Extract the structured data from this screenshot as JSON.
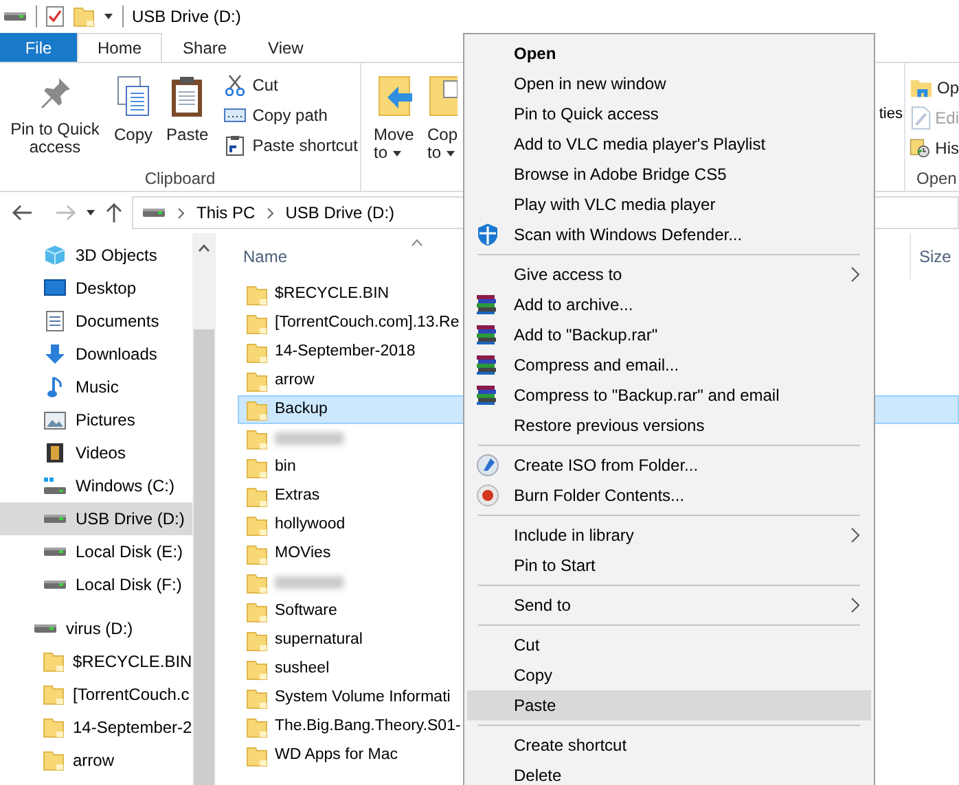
{
  "title_bar": {
    "title": "USB Drive (D:)"
  },
  "ribbon_tabs": [
    {
      "label": "File",
      "kind": "file",
      "selected": false
    },
    {
      "label": "Home",
      "kind": "tab",
      "selected": true
    },
    {
      "label": "Share",
      "kind": "tab",
      "selected": false
    },
    {
      "label": "View",
      "kind": "tab",
      "selected": false
    }
  ],
  "ribbon": {
    "clipboard": {
      "label": "Clipboard",
      "large_buttons": [
        "Pin to Quick access",
        "Copy",
        "Paste"
      ],
      "small_buttons": [
        "Cut",
        "Copy path",
        "Paste shortcut"
      ]
    },
    "organize": {
      "buttons": [
        {
          "lines": [
            "Move",
            "to"
          ]
        },
        {
          "lines": [
            "Cop",
            "to"
          ]
        }
      ]
    },
    "properties_fragment": "ties",
    "open": {
      "label": "Open",
      "buttons": [
        {
          "label": "Op",
          "disabled": false
        },
        {
          "label": "Edi",
          "disabled": true
        },
        {
          "label": "His",
          "disabled": false
        }
      ]
    }
  },
  "address_bar": {
    "crumbs": [
      "This PC",
      "USB Drive (D:)"
    ]
  },
  "navigation_pane": {
    "items": [
      {
        "label": "3D Objects",
        "selected": false
      },
      {
        "label": "Desktop",
        "selected": false
      },
      {
        "label": "Documents",
        "selected": false
      },
      {
        "label": "Downloads",
        "selected": false
      },
      {
        "label": "Music",
        "selected": false
      },
      {
        "label": "Pictures",
        "selected": false
      },
      {
        "label": "Videos",
        "selected": false
      },
      {
        "label": "Windows (C:)",
        "selected": false
      },
      {
        "label": "USB Drive (D:)",
        "selected": true
      },
      {
        "label": "Local Disk (E:)",
        "selected": false
      },
      {
        "label": "Local Disk (F:)",
        "selected": false
      }
    ],
    "tree": {
      "label": "virus (D:)",
      "children": [
        {
          "label": "$RECYCLE.BIN"
        },
        {
          "label": "[TorrentCouch.c"
        },
        {
          "label": "14-September-2"
        },
        {
          "label": "arrow"
        }
      ]
    }
  },
  "file_list": {
    "columns": [
      "Name",
      "Size"
    ],
    "rows": [
      {
        "kind": "folder",
        "name": "$RECYCLE.BIN",
        "selected": false
      },
      {
        "kind": "folder",
        "name": "[TorrentCouch.com].13.Re",
        "selected": false
      },
      {
        "kind": "folder",
        "name": "14-September-2018",
        "selected": false
      },
      {
        "kind": "folder",
        "name": "arrow",
        "selected": false
      },
      {
        "kind": "folder",
        "name": "Backup",
        "selected": true
      },
      {
        "kind": "blurred",
        "selected": false
      },
      {
        "kind": "folder",
        "name": "bin",
        "selected": false
      },
      {
        "kind": "folder",
        "name": "Extras",
        "selected": false
      },
      {
        "kind": "folder",
        "name": "hollywood",
        "selected": false
      },
      {
        "kind": "folder",
        "name": "MOVies",
        "selected": false
      },
      {
        "kind": "blurred",
        "selected": false
      },
      {
        "kind": "folder",
        "name": "Software",
        "selected": false
      },
      {
        "kind": "folder",
        "name": "supernatural",
        "selected": false
      },
      {
        "kind": "folder",
        "name": "susheel",
        "selected": false
      },
      {
        "kind": "folder",
        "name": "System Volume Informati",
        "selected": false
      },
      {
        "kind": "folder",
        "name": "The.Big.Bang.Theory.S01-",
        "selected": false
      },
      {
        "kind": "folder",
        "name": "WD Apps for Mac",
        "selected": false
      }
    ]
  },
  "context_menu": [
    {
      "kind": "item",
      "label": "Open",
      "default": true,
      "submenu": false,
      "selected": false
    },
    {
      "kind": "item",
      "label": "Open in new window",
      "default": false,
      "submenu": false,
      "selected": false
    },
    {
      "kind": "item",
      "label": "Pin to Quick access",
      "default": false,
      "submenu": false,
      "selected": false
    },
    {
      "kind": "item",
      "label": "Add to VLC media player's Playlist",
      "default": false,
      "submenu": false,
      "selected": false
    },
    {
      "kind": "item",
      "label": "Browse in Adobe Bridge CS5",
      "default": false,
      "submenu": false,
      "selected": false
    },
    {
      "kind": "item",
      "label": "Play with VLC media player",
      "default": false,
      "submenu": false,
      "selected": false
    },
    {
      "kind": "item",
      "label": "Scan with Windows Defender...",
      "default": false,
      "submenu": false,
      "selected": false
    },
    {
      "kind": "separator"
    },
    {
      "kind": "item",
      "label": "Give access to",
      "default": false,
      "submenu": true,
      "selected": false
    },
    {
      "kind": "item",
      "label": "Add to archive...",
      "default": false,
      "submenu": false,
      "selected": false
    },
    {
      "kind": "item",
      "label": "Add to \"Backup.rar\"",
      "default": false,
      "submenu": false,
      "selected": false
    },
    {
      "kind": "item",
      "label": "Compress and email...",
      "default": false,
      "submenu": false,
      "selected": false
    },
    {
      "kind": "item",
      "label": "Compress to \"Backup.rar\" and email",
      "default": false,
      "submenu": false,
      "selected": false
    },
    {
      "kind": "item",
      "label": "Restore previous versions",
      "default": false,
      "submenu": false,
      "selected": false
    },
    {
      "kind": "separator"
    },
    {
      "kind": "item",
      "label": "Create ISO from Folder...",
      "default": false,
      "submenu": false,
      "selected": false
    },
    {
      "kind": "item",
      "label": "Burn Folder Contents...",
      "default": false,
      "submenu": false,
      "selected": false
    },
    {
      "kind": "separator"
    },
    {
      "kind": "item",
      "label": "Include in library",
      "default": false,
      "submenu": true,
      "selected": false
    },
    {
      "kind": "item",
      "label": "Pin to Start",
      "default": false,
      "submenu": false,
      "selected": false
    },
    {
      "kind": "separator"
    },
    {
      "kind": "item",
      "label": "Send to",
      "default": false,
      "submenu": true,
      "selected": false
    },
    {
      "kind": "separator"
    },
    {
      "kind": "item",
      "label": "Cut",
      "default": false,
      "submenu": false,
      "selected": false
    },
    {
      "kind": "item",
      "label": "Copy",
      "default": false,
      "submenu": false,
      "selected": false
    },
    {
      "kind": "item",
      "label": "Paste",
      "default": false,
      "submenu": false,
      "selected": true
    },
    {
      "kind": "separator"
    },
    {
      "kind": "item",
      "label": "Create shortcut",
      "default": false,
      "submenu": false,
      "selected": false
    },
    {
      "kind": "item",
      "label": "Delete",
      "default": false,
      "submenu": false,
      "selected": false
    }
  ]
}
